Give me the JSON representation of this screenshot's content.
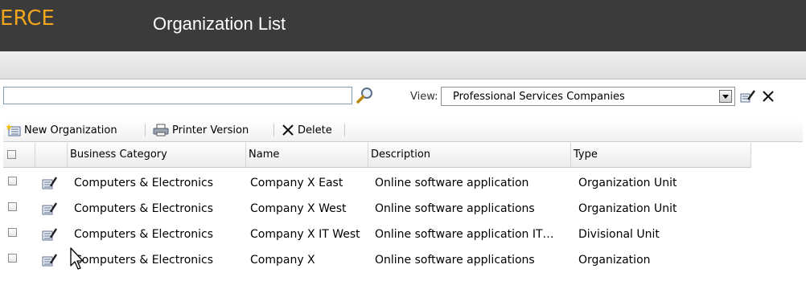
{
  "header": {
    "brand": "ERCE",
    "title": "Organization List"
  },
  "search": {
    "value": "",
    "placeholder": ""
  },
  "view": {
    "label": "View:",
    "selected": "Professional Services Companies"
  },
  "toolbar": {
    "new_label": "New Organization",
    "printer_label": "Printer Version",
    "delete_label": "Delete"
  },
  "table": {
    "columns": [
      "Business Category",
      "Name",
      "Description",
      "Type"
    ],
    "rows": [
      {
        "category": "Computers & Electronics",
        "name": "Company X East",
        "description": "Online software application",
        "type": "Organization Unit"
      },
      {
        "category": "Computers & Electronics",
        "name": "Company X West",
        "description": "Online software applications",
        "type": "Organization Unit"
      },
      {
        "category": "Computers & Electronics",
        "name": "Company X IT West",
        "description": "Online software application IT…",
        "type": "Divisional Unit"
      },
      {
        "category": "Computers & Electronics",
        "name": "Company X",
        "description": "Online software applications",
        "type": "Organization"
      }
    ]
  },
  "colors": {
    "titlebar": "#3b3b3b",
    "brand": "#f0a51d",
    "title_text": "#ffffff"
  },
  "icons": [
    "search-icon",
    "edit-view-icon",
    "close-icon",
    "new-record-icon",
    "printer-icon",
    "delete-icon",
    "edit-record-icon",
    "mouse-cursor-icon"
  ]
}
